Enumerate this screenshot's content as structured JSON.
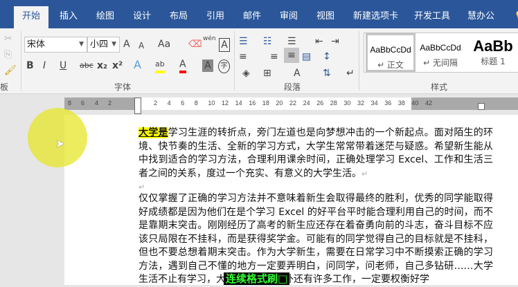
{
  "tabs": [
    "开始",
    "插入",
    "绘图",
    "设计",
    "布局",
    "引用",
    "邮件",
    "审阅",
    "视图",
    "新建选项卡",
    "开发工具",
    "慧办公"
  ],
  "ribbon": {
    "font_name": "宋体",
    "font_size": "小四",
    "groups": {
      "clipboard": "板",
      "font": "字体",
      "paragraph": "段落",
      "styles": "样式"
    },
    "font_buttons": {
      "grow": "A",
      "shrink": "A",
      "case": "Aa",
      "bold": "B",
      "italic": "I",
      "underline": "U",
      "strike": "abc",
      "sub": "x₂",
      "sup": "x²",
      "phonetic": "wén",
      "border": "A",
      "effects": "A",
      "highlight": "ab",
      "color": "A",
      "shading": "A",
      "enclose": "字"
    },
    "styles": [
      {
        "sample": "AaBbCcDd",
        "name": "↵ 正文"
      },
      {
        "sample": "AaBbCcDd",
        "name": "↵ 无间隔"
      },
      {
        "sample": "AaBb",
        "name": "标题 1"
      }
    ]
  },
  "colors": {
    "brand": "#2b579a",
    "highlight": "#ffff00",
    "font_color": "#ff0000",
    "tip_text": "#33ff33"
  },
  "ruler": {
    "left": [
      "8",
      "6",
      "4",
      "2"
    ],
    "right": [
      "2",
      "4",
      "6",
      "8",
      "10",
      "12",
      "14",
      "16",
      "18",
      "20",
      "22",
      "24",
      "26",
      "28",
      "30",
      "32",
      "34",
      "36",
      "38",
      "40",
      "42"
    ]
  },
  "doc": {
    "p1_highlight": "大学是",
    "p1_rest": "学习生涯的转折点，旁门左道也是向梦想冲击的一个新起点。面对陌生的环境、快节奏的生活、全新的学习方式，大学生常常带着迷茫与疑惑。希望新生能从中找到适合的学习方法，合理利用课余时间，正确处理学习 Excel、工作和生活三者之间的关系，度过一个充实、有意义的大学生活。",
    "mark": "↵",
    "p2": "仅仅掌握了正确的学习方法并不意味着新生会取得最终的胜利，优秀的同学能取得好成绩都是因为他们在是个学习 Excel 的好平台平时能合理利用自己的时间，而不是靠期末突击。刚刚经历了高考的新生应还存在着奋勇向前的斗志，奋斗目标不应该只局限在不挂科，而是获得奖学金。可能有的同学觉得自己的目标就是不挂科，但也不要总想着期末突击。作为大学新生，需要在日常学习中不断摸索正确的学习方法，遇到自己不懂的地方一定要弄明白，问同学，问老师，自己多钻研……大学生活不止有学习，大学除了学习之外还有许多工作，一定要权衡好学"
  },
  "tooltip": "连续格式刷□"
}
